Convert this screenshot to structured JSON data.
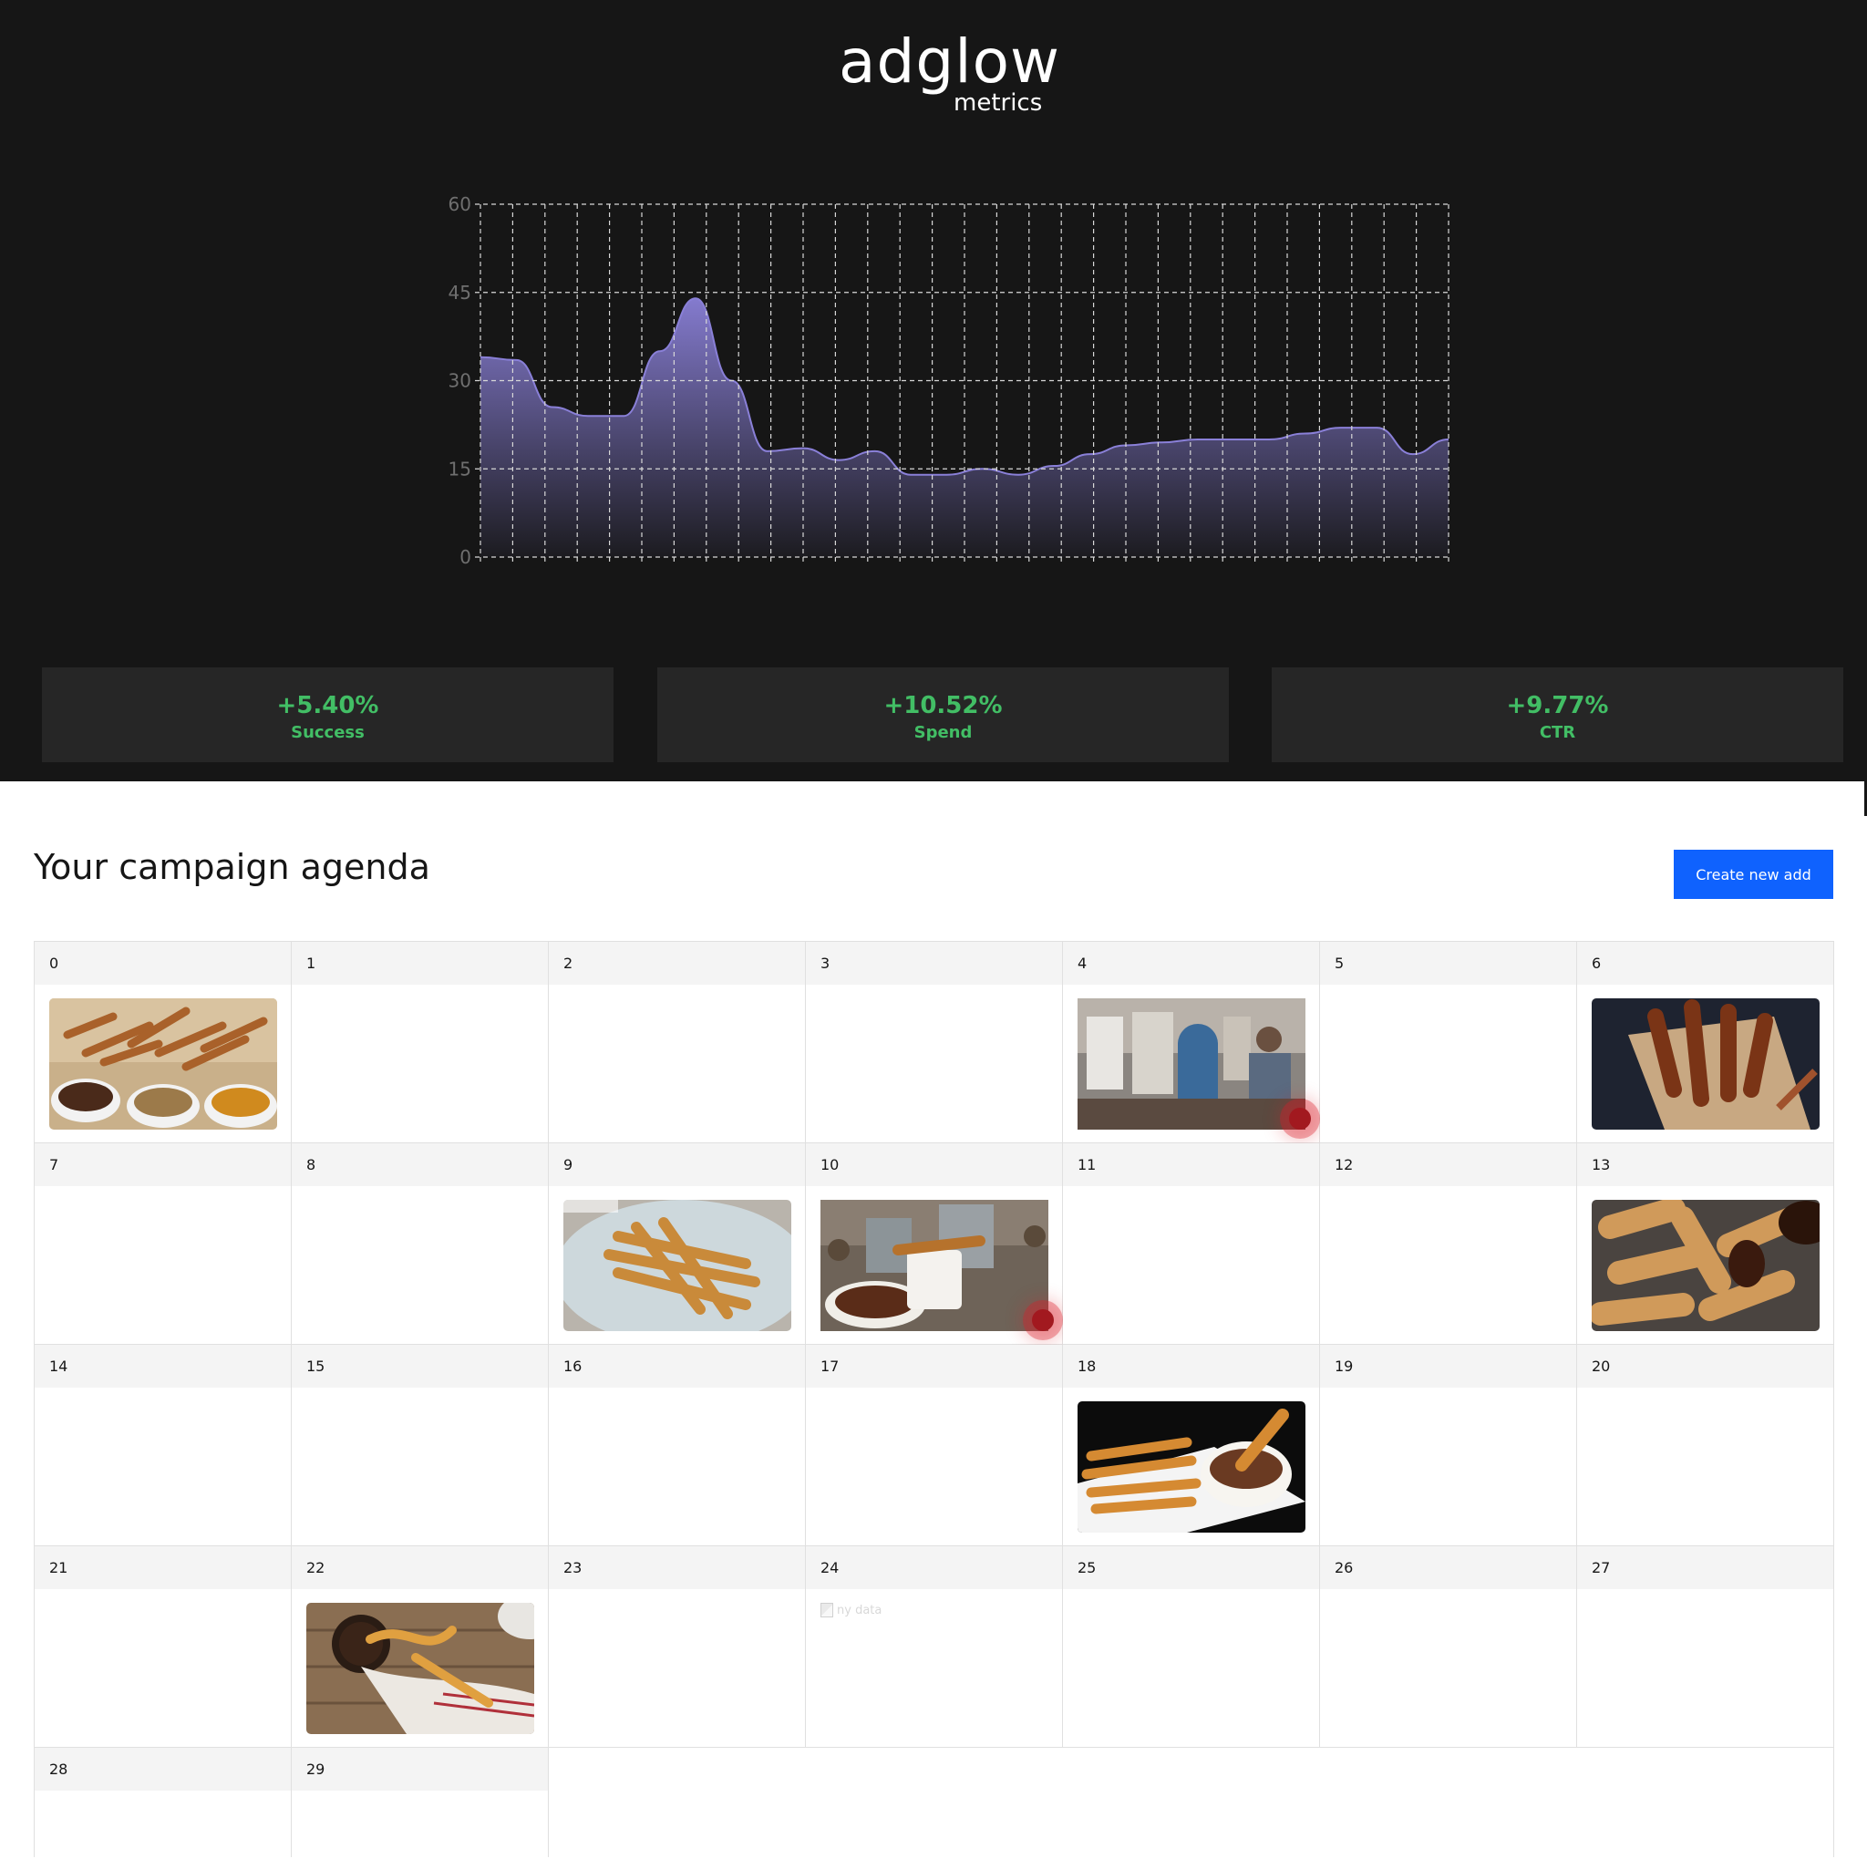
{
  "brand": {
    "name": "adglow",
    "tagline": "metrics"
  },
  "chart_data": {
    "type": "area",
    "title": "",
    "xlabel": "",
    "ylabel": "",
    "ylim": [
      0,
      60
    ],
    "yticks": [
      "0",
      "15",
      "30",
      "45",
      "60"
    ],
    "grid": true,
    "x": [
      0,
      1,
      2,
      3,
      4,
      5,
      6,
      7,
      8,
      9,
      10,
      11,
      12,
      13,
      14,
      15,
      16,
      17,
      18,
      19,
      20,
      21,
      22,
      23,
      24,
      25,
      26,
      27,
      28,
      29,
      30
    ],
    "values": [
      34,
      33.5,
      25.5,
      24,
      24,
      35,
      44,
      30,
      18,
      18.5,
      16.5,
      18,
      14,
      14,
      15,
      14,
      15.5,
      17.5,
      19,
      19.5,
      20,
      20,
      20,
      21,
      22,
      22,
      17.5,
      20
    ],
    "series_color": "#8a80d8"
  },
  "kpis": [
    {
      "value": "+5.40%",
      "label": "Success"
    },
    {
      "value": "+10.52%",
      "label": "Spend"
    },
    {
      "value": "+9.77%",
      "label": "CTR"
    }
  ],
  "agenda": {
    "title": "Your campaign agenda",
    "create_button": "Create new add",
    "broken_image_alt": "ny data"
  },
  "days": [
    {
      "label": "0",
      "image": "churros-with-three-dips"
    },
    {
      "label": "1"
    },
    {
      "label": "2"
    },
    {
      "label": "3"
    },
    {
      "label": "4",
      "image": "man-in-restaurant",
      "flag": true
    },
    {
      "label": "5"
    },
    {
      "label": "6",
      "image": "churros-in-paper-cone"
    },
    {
      "label": "7"
    },
    {
      "label": "8"
    },
    {
      "label": "9",
      "image": "churros-on-plate"
    },
    {
      "label": "10",
      "image": "churros-with-hot-chocolate",
      "flag": true
    },
    {
      "label": "11"
    },
    {
      "label": "12"
    },
    {
      "label": "13",
      "image": "churros-closeup-chocolate"
    },
    {
      "label": "14"
    },
    {
      "label": "15"
    },
    {
      "label": "16"
    },
    {
      "label": "17"
    },
    {
      "label": "18",
      "image": "churros-with-cup"
    },
    {
      "label": "19"
    },
    {
      "label": "20"
    },
    {
      "label": "21"
    },
    {
      "label": "22",
      "image": "churros-mug-on-wood"
    },
    {
      "label": "23"
    },
    {
      "label": "24",
      "broken": true
    },
    {
      "label": "25"
    },
    {
      "label": "26"
    },
    {
      "label": "27"
    },
    {
      "label": "28"
    },
    {
      "label": "29"
    }
  ],
  "colors": {
    "header_bg": "#161616",
    "kpi_bg": "#262626",
    "kpi_text": "#42be65",
    "button": "#0f62fe",
    "flag": "#a2191f"
  }
}
